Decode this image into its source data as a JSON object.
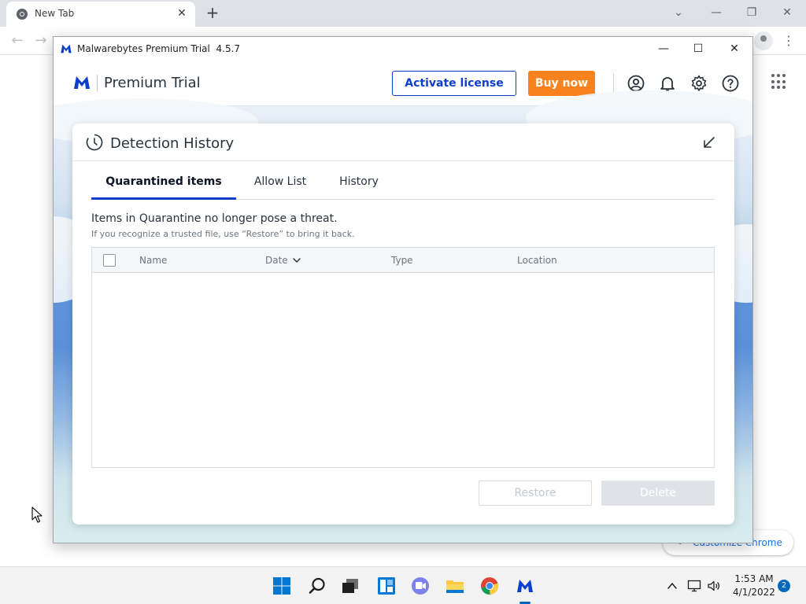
{
  "chrome": {
    "tab_title": "New Tab",
    "customize_label": "Customize Chrome"
  },
  "window": {
    "title": "Malwarebytes Premium Trial  4.5.7"
  },
  "header": {
    "product_name": "Premium Trial",
    "activate_label": "Activate license",
    "buy_label": "Buy now",
    "icons": [
      "account-icon",
      "notifications-icon",
      "settings-icon",
      "help-icon"
    ],
    "brand_color": "#0d3ecc",
    "buy_color": "#f7821e"
  },
  "panel": {
    "title": "Detection History",
    "tabs": [
      {
        "label": "Quarantined items",
        "active": true
      },
      {
        "label": "Allow List",
        "active": false
      },
      {
        "label": "History",
        "active": false
      }
    ],
    "info_main": "Items in Quarantine no longer pose a threat.",
    "info_sub": "If you recognize a trusted file, use “Restore” to bring it back.",
    "columns": [
      "Name",
      "Date",
      "Type",
      "Location"
    ],
    "sorted_column": "Date",
    "rows": [],
    "restore_label": "Restore",
    "delete_label": "Delete"
  },
  "taskbar": {
    "apps": [
      "start-icon",
      "search-icon",
      "task-view-icon",
      "widgets-icon",
      "teams-chat-icon",
      "file-explorer-icon",
      "chrome-icon",
      "malwarebytes-icon"
    ],
    "tray": [
      "show-hidden-icons",
      "network-icon",
      "volume-icon"
    ],
    "time": "1:53 AM",
    "date": "4/1/2022",
    "notification_count": "2"
  }
}
